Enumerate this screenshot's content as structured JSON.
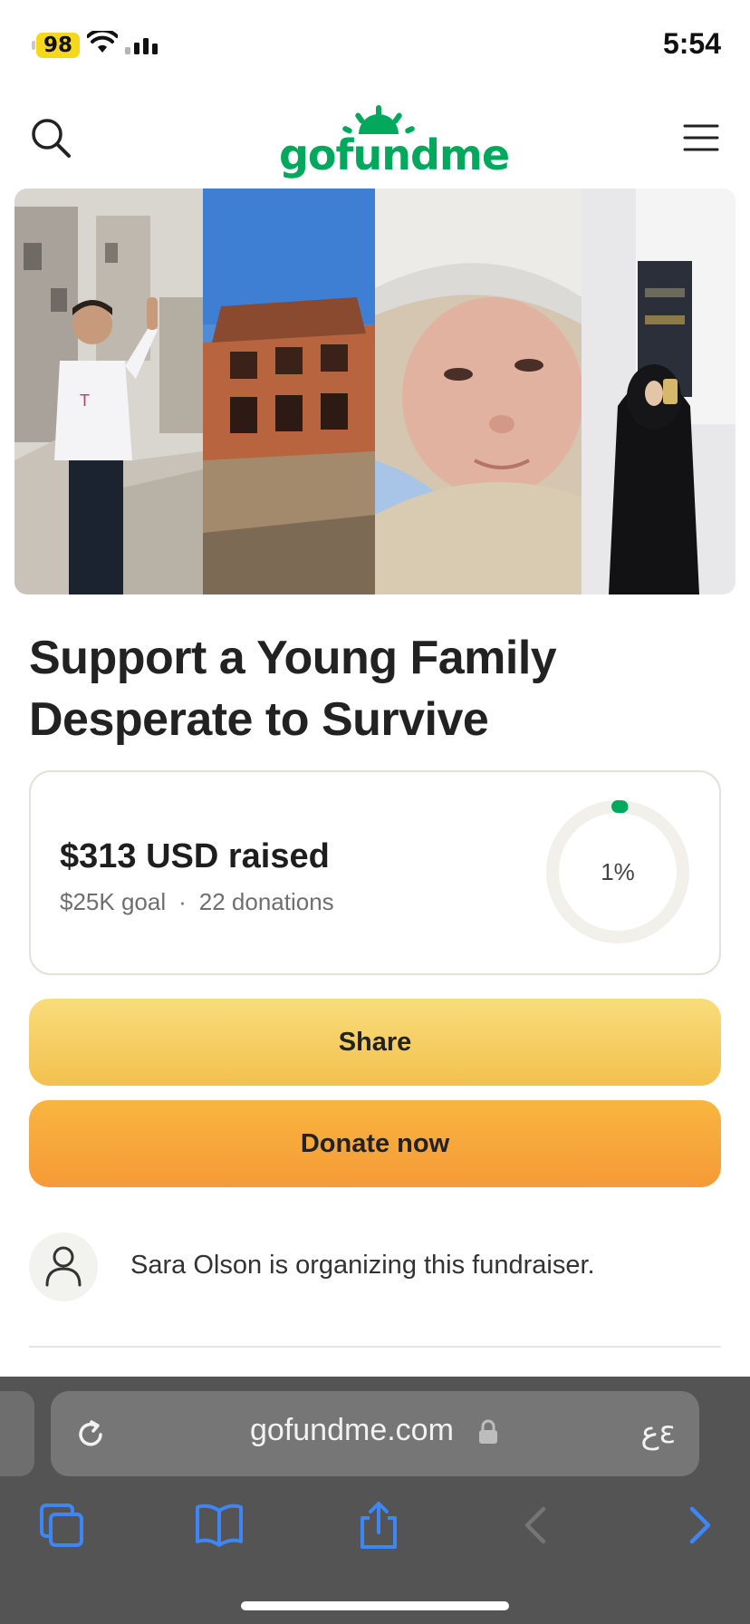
{
  "status_bar": {
    "battery": "98",
    "time": "5:54"
  },
  "header": {
    "logo_text": "gofundme",
    "search_icon": "search-icon",
    "menu_icon": "hamburger-menu-icon"
  },
  "hero": {
    "panels": [
      "man-in-rubble-photo",
      "damaged-building-photo",
      "newborn-baby-photo",
      "woman-selfie-photo"
    ]
  },
  "campaign": {
    "title": "Support a Young Family Desperate to Survive",
    "raised": "$313 USD raised",
    "goal": "$25K goal",
    "separator": "·",
    "donations": "22 donations",
    "progress_label": "1%",
    "progress_fraction": 0.01
  },
  "actions": {
    "share_label": "Share",
    "donate_label": "Donate now"
  },
  "organizer": {
    "text": "Sara Olson is organizing this fundraiser."
  },
  "browser": {
    "url": "gofundme.com",
    "reader_glyph": "عɛ"
  },
  "colors": {
    "brand_green": "#02a95c",
    "share_yellow": "#f6ce5f",
    "donate_orange": "#f7a63b",
    "toolbar_blue": "#3d86f6"
  }
}
